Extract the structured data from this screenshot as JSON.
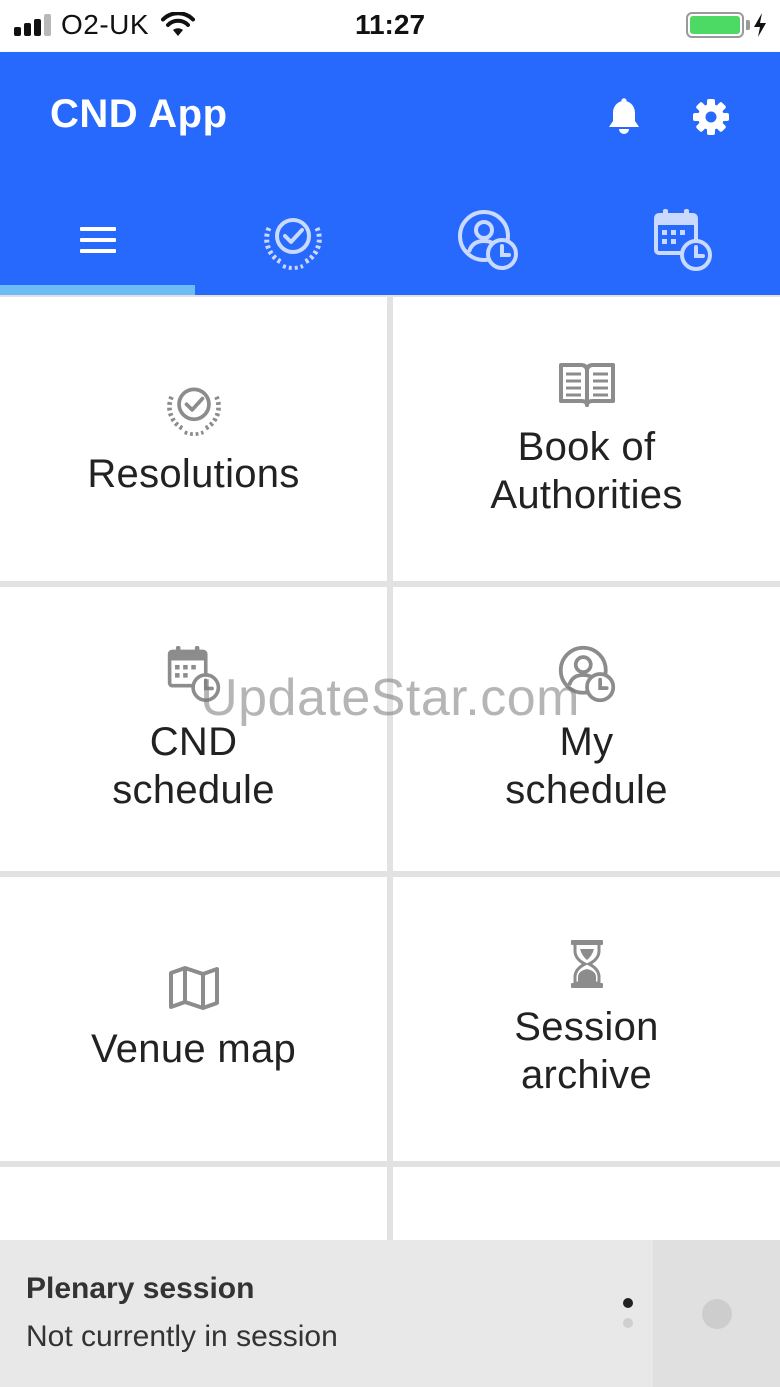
{
  "status_bar": {
    "carrier": "O2-UK",
    "time": "11:27",
    "signal_bars": 3,
    "battery_level": 1.0,
    "battery_color": "#4cd964",
    "charging": true
  },
  "header": {
    "title": "CND App",
    "background": "#2669fc",
    "notifications_icon": "bell-icon",
    "settings_icon": "gear-icon"
  },
  "tabs": [
    {
      "icon": "menu-icon",
      "active": true
    },
    {
      "icon": "resolutions-badge-icon",
      "active": false
    },
    {
      "icon": "my-schedule-icon",
      "active": false
    },
    {
      "icon": "calendar-clock-icon",
      "active": false
    }
  ],
  "tiles": [
    {
      "label": "Resolutions",
      "icon": "resolutions-badge-icon"
    },
    {
      "label": "Book of\nAuthorities",
      "icon": "open-book-icon"
    },
    {
      "label": "CND\nschedule",
      "icon": "calendar-clock-icon"
    },
    {
      "label": "My\nschedule",
      "icon": "my-schedule-icon"
    },
    {
      "label": "Venue map",
      "icon": "map-icon"
    },
    {
      "label": "Session\narchive",
      "icon": "hourglass-icon"
    }
  ],
  "watermark": "UpdateStar.com",
  "plenary": {
    "title": "Plenary session",
    "status": "Not currently in session"
  }
}
